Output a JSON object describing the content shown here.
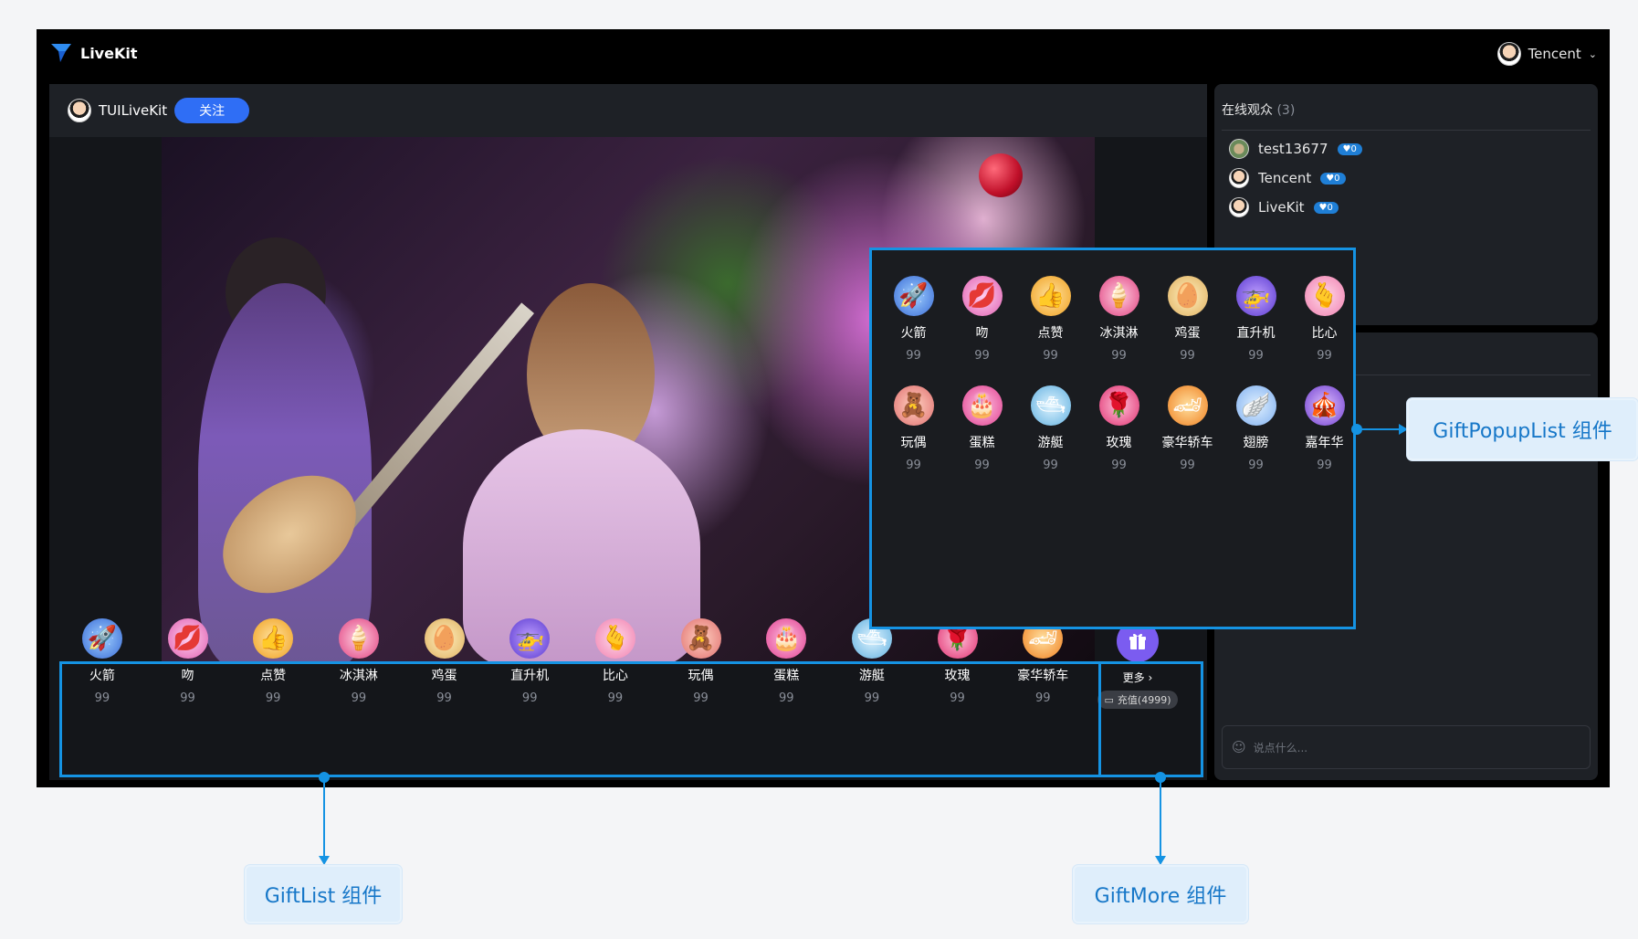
{
  "app": {
    "name": "LiveKit",
    "user_name": "Tencent"
  },
  "host": {
    "name": "TUILiveKit",
    "follow_label": "关注"
  },
  "viewers": {
    "title": "在线观众",
    "count": "(3)",
    "items": [
      {
        "name": "test13677",
        "badge": "♥0"
      },
      {
        "name": "Tencent",
        "badge": "♥0"
      },
      {
        "name": "LiveKit",
        "badge": "♥0"
      }
    ]
  },
  "gift_list": [
    {
      "name": "火箭",
      "price": "99",
      "icon": "rocket-icon"
    },
    {
      "name": "吻",
      "price": "99",
      "icon": "kiss-icon"
    },
    {
      "name": "点赞",
      "price": "99",
      "icon": "thumbs-up-icon"
    },
    {
      "name": "冰淇淋",
      "price": "99",
      "icon": "ice-cream-icon"
    },
    {
      "name": "鸡蛋",
      "price": "99",
      "icon": "egg-icon"
    },
    {
      "name": "直升机",
      "price": "99",
      "icon": "helicopter-icon"
    },
    {
      "name": "比心",
      "price": "99",
      "icon": "finger-heart-icon"
    },
    {
      "name": "玩偶",
      "price": "99",
      "icon": "teddy-bear-icon"
    },
    {
      "name": "蛋糕",
      "price": "99",
      "icon": "cake-icon"
    },
    {
      "name": "游艇",
      "price": "99",
      "icon": "yacht-icon"
    },
    {
      "name": "玫瑰",
      "price": "99",
      "icon": "rose-icon"
    },
    {
      "name": "豪华轿车",
      "price": "99",
      "icon": "sports-car-icon"
    }
  ],
  "gift_popup": [
    {
      "name": "火箭",
      "price": "99",
      "icon": "rocket-icon"
    },
    {
      "name": "吻",
      "price": "99",
      "icon": "kiss-icon"
    },
    {
      "name": "点赞",
      "price": "99",
      "icon": "thumbs-up-icon"
    },
    {
      "name": "冰淇淋",
      "price": "99",
      "icon": "ice-cream-icon"
    },
    {
      "name": "鸡蛋",
      "price": "99",
      "icon": "egg-icon"
    },
    {
      "name": "直升机",
      "price": "99",
      "icon": "helicopter-icon"
    },
    {
      "name": "比心",
      "price": "99",
      "icon": "finger-heart-icon"
    },
    {
      "name": "玩偶",
      "price": "99",
      "icon": "teddy-bear-icon"
    },
    {
      "name": "蛋糕",
      "price": "99",
      "icon": "cake-icon"
    },
    {
      "name": "游艇",
      "price": "99",
      "icon": "yacht-icon"
    },
    {
      "name": "玫瑰",
      "price": "99",
      "icon": "rose-icon"
    },
    {
      "name": "豪华轿车",
      "price": "99",
      "icon": "sports-car-icon"
    },
    {
      "name": "翅膀",
      "price": "99",
      "icon": "wings-icon"
    },
    {
      "name": "嘉年华",
      "price": "99",
      "icon": "carnival-icon"
    }
  ],
  "gift_more": {
    "label": "更多",
    "recharge_label": "充值(4999)"
  },
  "chat": {
    "placeholder": "说点什么..."
  },
  "callouts": {
    "gift_list": "GiftList 组件",
    "gift_more": "GiftMore 组件",
    "gift_popup": "GiftPopupList 组件"
  },
  "colors": {
    "highlight": "#1593e3",
    "follow": "#2f6ef5",
    "more_button": "#7b5cf0"
  }
}
